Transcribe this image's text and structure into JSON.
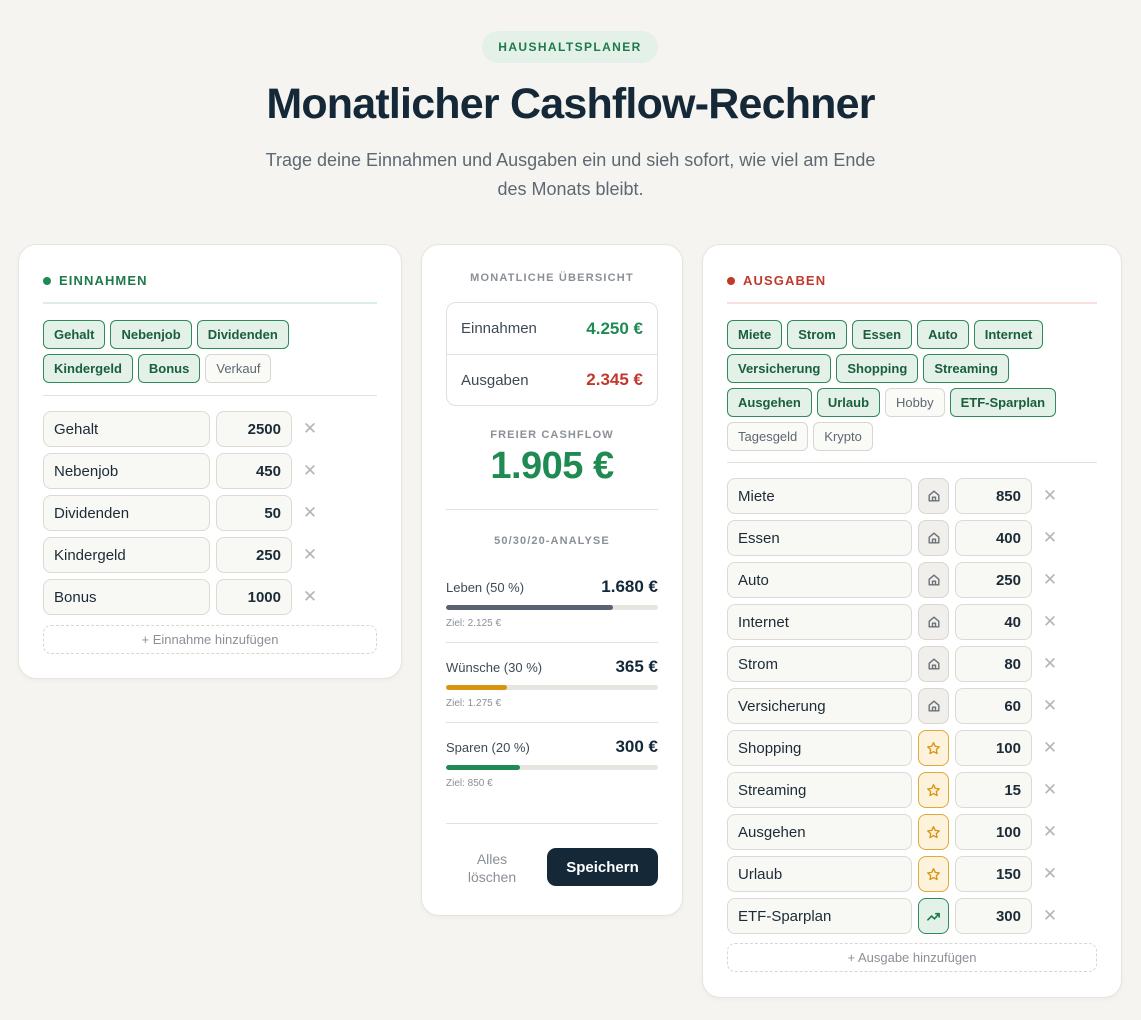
{
  "header": {
    "badge": "HAUSHALTSPLANER",
    "title": "Monatlicher Cashflow-Rechner",
    "subtitle": "Trage deine Einnahmen und Ausgaben ein und sieh sofort, wie viel am Ende des Monats bleibt."
  },
  "income": {
    "heading": "EINNAHMEN",
    "accent": "#1f8a52",
    "chips": [
      {
        "label": "Gehalt",
        "active": true
      },
      {
        "label": "Nebenjob",
        "active": true
      },
      {
        "label": "Dividenden",
        "active": true
      },
      {
        "label": "Kindergeld",
        "active": true
      },
      {
        "label": "Bonus",
        "active": true
      },
      {
        "label": "Verkauf",
        "active": false
      }
    ],
    "rows": [
      {
        "name": "Gehalt",
        "amount": "2500"
      },
      {
        "name": "Nebenjob",
        "amount": "450"
      },
      {
        "name": "Dividenden",
        "amount": "50"
      },
      {
        "name": "Kindergeld",
        "amount": "250"
      },
      {
        "name": "Bonus",
        "amount": "1000"
      }
    ],
    "add_label": "+ Einnahme hinzufügen"
  },
  "summary": {
    "title": "MONATLICHE ÜBERSICHT",
    "income_label": "Einnahmen",
    "income_value": "4.250 €",
    "expense_label": "Ausgaben",
    "expense_value": "2.345 €",
    "cashflow_label": "FREIER CASHFLOW",
    "cashflow_value": "1.905 €",
    "analysis_title": "50/30/20-ANALYSE",
    "buckets": [
      {
        "label": "Leben (50 %)",
        "amount": "1.680 €",
        "goal": "Ziel: 2.125 €",
        "progress": 0.79,
        "color": "#5a6173"
      },
      {
        "label": "Wünsche (30 %)",
        "amount": "365 €",
        "goal": "Ziel: 1.275 €",
        "progress": 0.29,
        "color": "#d9940f"
      },
      {
        "label": "Sparen (20 %)",
        "amount": "300 €",
        "goal": "Ziel: 850 €",
        "progress": 0.35,
        "color": "#1f8a52"
      }
    ],
    "clear_label": "Alles löschen",
    "save_label": "Speichern"
  },
  "expenses": {
    "heading": "AUSGABEN",
    "accent": "#c0392b",
    "chips": [
      {
        "label": "Miete",
        "active": true
      },
      {
        "label": "Strom",
        "active": true
      },
      {
        "label": "Essen",
        "active": true
      },
      {
        "label": "Auto",
        "active": true
      },
      {
        "label": "Internet",
        "active": true
      },
      {
        "label": "Versicherung",
        "active": true
      },
      {
        "label": "Shopping",
        "active": true
      },
      {
        "label": "Streaming",
        "active": true
      },
      {
        "label": "Ausgehen",
        "active": true
      },
      {
        "label": "Urlaub",
        "active": true
      },
      {
        "label": "Hobby",
        "active": false
      },
      {
        "label": "ETF-Sparplan",
        "active": true
      },
      {
        "label": "Tagesgeld",
        "active": false
      },
      {
        "label": "Krypto",
        "active": false
      }
    ],
    "rows": [
      {
        "name": "Miete",
        "amount": "850",
        "category": "home-icon"
      },
      {
        "name": "Essen",
        "amount": "400",
        "category": "home-icon"
      },
      {
        "name": "Auto",
        "amount": "250",
        "category": "home-icon"
      },
      {
        "name": "Internet",
        "amount": "40",
        "category": "home-icon"
      },
      {
        "name": "Strom",
        "amount": "80",
        "category": "home-icon"
      },
      {
        "name": "Versicherung",
        "amount": "60",
        "category": "home-icon"
      },
      {
        "name": "Shopping",
        "amount": "100",
        "category": "star-icon"
      },
      {
        "name": "Streaming",
        "amount": "15",
        "category": "star-icon"
      },
      {
        "name": "Ausgehen",
        "amount": "100",
        "category": "star-icon"
      },
      {
        "name": "Urlaub",
        "amount": "150",
        "category": "star-icon"
      },
      {
        "name": "ETF-Sparplan",
        "amount": "300",
        "category": "trend-icon"
      }
    ],
    "add_label": "+ Ausgabe hinzufügen"
  }
}
